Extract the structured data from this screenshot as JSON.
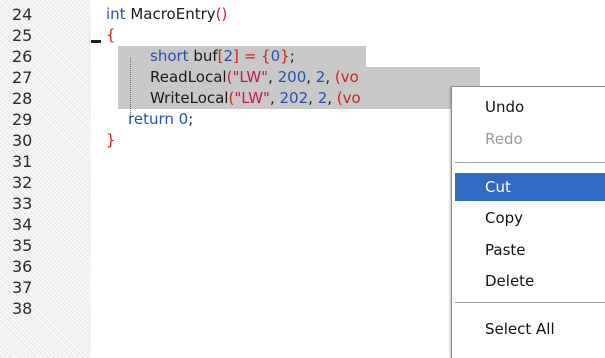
{
  "editor": {
    "line_numbers": [
      "24",
      "25",
      "26",
      "27",
      "28",
      "29",
      "30",
      "31",
      "32",
      "33",
      "34",
      "35",
      "36",
      "37",
      "38"
    ],
    "lines": {
      "l24": {
        "kw": "int",
        "rest": " MacroEntry",
        "paren": "()"
      },
      "l25": {
        "brace": "{"
      },
      "l26": {
        "kw": "short",
        "p1": " buf",
        "b1": "[",
        "n1": "2",
        "b2": "]",
        "p2": " ",
        "eq": "=",
        "p3": " ",
        "b3": "{",
        "n2": "0",
        "b4": "}",
        "semi": ";"
      },
      "l27": {
        "fn": "ReadLocal",
        "paren": "(",
        "str": "\"LW\"",
        "p1": ", ",
        "n1": "200",
        "p2": ", ",
        "n2": "2",
        "p3": ", ",
        "tail": "(vo"
      },
      "l28": {
        "fn": "WriteLocal",
        "paren": "(",
        "str": "\"LW\"",
        "p1": ", ",
        "n1": "202",
        "p2": ", ",
        "n2": "2",
        "p3": ", ",
        "tail": "(vo"
      },
      "l29": {
        "kw": "return",
        "p1": " ",
        "n1": "0",
        "semi": ";"
      },
      "l30": {
        "brace": "}"
      }
    }
  },
  "context_menu": {
    "items": [
      {
        "label": "Undo",
        "enabled": true
      },
      {
        "label": "Redo",
        "enabled": false
      },
      {
        "label": "Cut",
        "enabled": true,
        "highlighted": true
      },
      {
        "label": "Copy",
        "enabled": true
      },
      {
        "label": "Paste",
        "enabled": true
      },
      {
        "label": "Delete",
        "enabled": true
      },
      {
        "label": "Select All",
        "enabled": true
      }
    ]
  },
  "colors": {
    "selection": "#c8c8c8",
    "menu_highlight": "#316ac5",
    "keyword": "#2a4fb0",
    "string": "#c2185b",
    "operator": "#d12020"
  },
  "icons": [
    "fold-collapse-icon"
  ]
}
